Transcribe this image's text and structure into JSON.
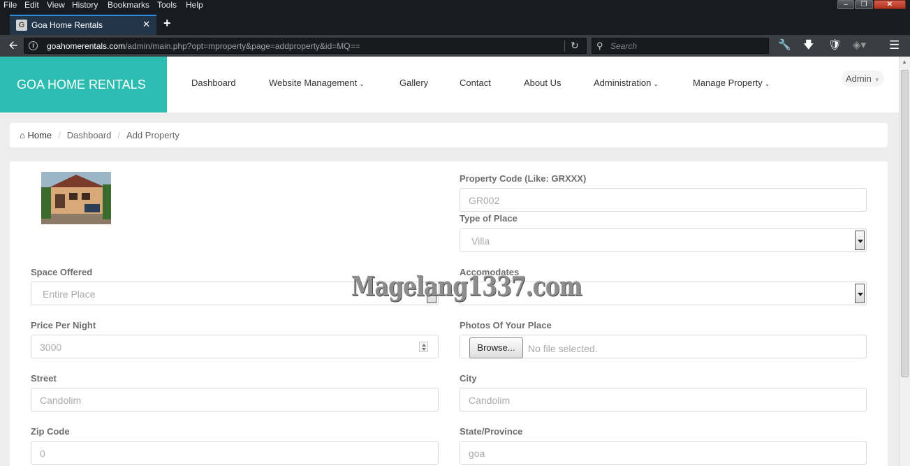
{
  "browser": {
    "menu": [
      "File",
      "Edit",
      "View",
      "History",
      "Bookmarks",
      "Tools",
      "Help"
    ],
    "tab_title": "Goa Home Rentals",
    "url_host": "goahomerentals.com",
    "url_path": "/admin/main.php?opt=mproperty&page=addproperty&id=MQ==",
    "search_placeholder": "Search"
  },
  "header": {
    "brand": "GOA HOME RENTALS",
    "nav": [
      "Dashboard",
      "Website Management",
      "Gallery",
      "Contact",
      "About Us",
      "Administration",
      "Manage Property"
    ],
    "user": "Admin"
  },
  "breadcrumb": [
    "Home",
    "Dashboard",
    "Add Property"
  ],
  "form": {
    "property_code_label": "Property Code (Like: GRXXX)",
    "property_code_value": "GR002",
    "type_label": "Type of Place",
    "type_value": "Villa",
    "space_label": "Space Offered",
    "space_value": "Entire Place",
    "accomodates_label": "Accomodates",
    "accomodates_value": "",
    "price_label": "Price Per Night",
    "price_value": "3000",
    "photos_label": "Photos Of Your Place",
    "browse_label": "Browse...",
    "no_file": "No file selected.",
    "street_label": "Street",
    "street_value": "Candolim",
    "city_label": "City",
    "city_value": "Candolim",
    "zip_label": "Zip Code",
    "zip_value": "0",
    "state_label": "State/Province",
    "state_value": "goa"
  },
  "watermark": "Magelang1337.com",
  "colors": {
    "brand": "#2dbcb1",
    "page_bg": "#ededed",
    "chrome": "#181b1f"
  }
}
